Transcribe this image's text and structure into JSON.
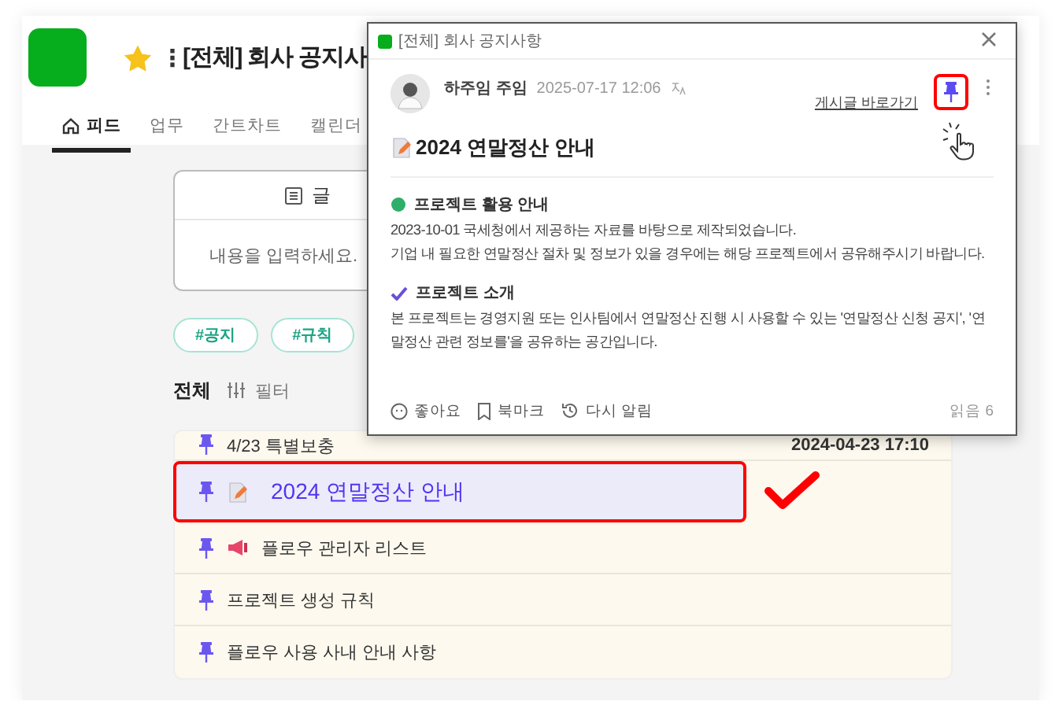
{
  "header": {
    "title": "[전체] 회사 공지사",
    "starred": true,
    "menu_glyph": "⋮"
  },
  "tabs": [
    {
      "label": "피드",
      "selected": true
    },
    {
      "label": "업무",
      "selected": false
    },
    {
      "label": "간트차트",
      "selected": false
    },
    {
      "label": "캘린더",
      "selected": false
    }
  ],
  "composer": {
    "mode_label": "글",
    "placeholder": "내용을 입력하세요."
  },
  "tags": [
    "#공지",
    "#규칙"
  ],
  "filter": {
    "scope": "전체",
    "label": "필터"
  },
  "pinned_posts": [
    {
      "title": "4/23 특별보충",
      "kind": "plain",
      "date": "2024-04-23 17:10",
      "selected": false
    },
    {
      "title": "2024 연말정산 안내",
      "kind": "memo",
      "selected": true
    },
    {
      "title": "플로우 관리자 리스트",
      "kind": "megaphone",
      "selected": false
    },
    {
      "title": "프로젝트 생성 규칙",
      "kind": "plain",
      "selected": false
    },
    {
      "title": "플로우 사용 사내 안내 사항",
      "kind": "plain",
      "selected": false
    }
  ],
  "popup": {
    "project": "[전체] 회사 공지사항",
    "author": "하주임 주임",
    "time": "2025-07-17 12:06",
    "go_to_post": "게시글 바로가기",
    "pinned": true,
    "title": "2024 연말정산 안내",
    "sections": [
      {
        "kind": "circle",
        "heading": "프로젝트 활용 안내",
        "lines": [
          "2023-10-01 국세청에서 제공하는 자료를 바탕으로 제작되었습니다.",
          "기업 내 필요한 연말정산 절차 및 정보가 있을 경우에는 해당 프로젝트에서 공유해주시기 바랍니다."
        ]
      },
      {
        "kind": "check",
        "heading": "프로젝트 소개",
        "lines": [
          "본 프로젝트는 경영지원 또는 인사팀에서 연말정산 진행 시 사용할 수 있는 '연말정산 신청 공지', '연말정산 관련 정보를'을 공유하는 공간입니다."
        ]
      }
    ],
    "actions": [
      {
        "kind": "like",
        "label": "좋아요"
      },
      {
        "kind": "bookmark",
        "label": "북마크"
      },
      {
        "kind": "remind",
        "label": "다시 알림"
      }
    ],
    "read_count": "읽음 6"
  }
}
